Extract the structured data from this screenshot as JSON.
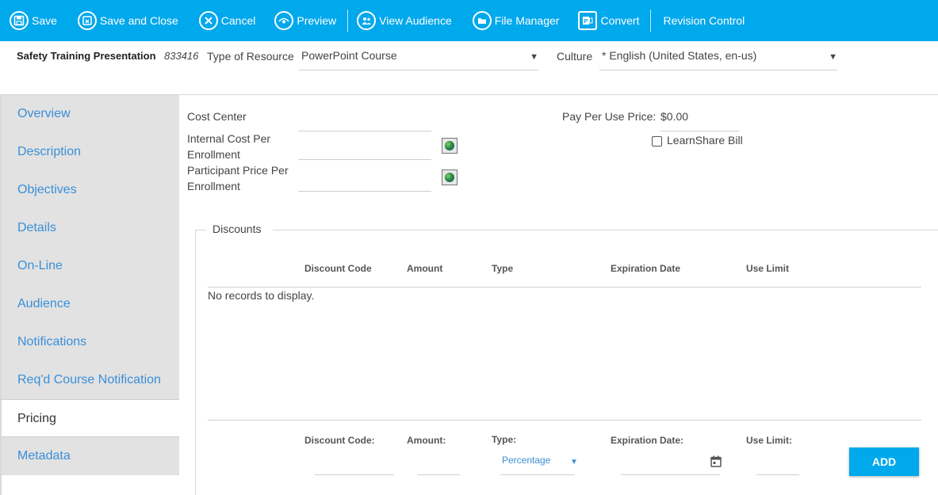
{
  "toolbar": {
    "save": "Save",
    "save_and_close": "Save and Close",
    "cancel": "Cancel",
    "preview": "Preview",
    "view_audience": "View Audience",
    "file_manager": "File Manager",
    "convert": "Convert",
    "revision_control": "Revision Control",
    "background_color": "#00a8ec"
  },
  "header": {
    "course_title": "Safety Training Presentation",
    "course_id": "833416",
    "type_of_resource_label": "Type of Resource",
    "type_of_resource_value": "PowerPoint Course",
    "culture_label": "Culture",
    "culture_value": "* English (United States, en-us)"
  },
  "sidebar": {
    "items": [
      {
        "label": "Overview"
      },
      {
        "label": "Description"
      },
      {
        "label": "Objectives"
      },
      {
        "label": "Details"
      },
      {
        "label": "On-Line"
      },
      {
        "label": "Audience"
      },
      {
        "label": "Notifications"
      },
      {
        "label": "Req'd Course Notification"
      },
      {
        "label": "Pricing"
      },
      {
        "label": "Metadata"
      }
    ],
    "active": "Pricing",
    "link_color": "#3a8fd8"
  },
  "pricing": {
    "cost_center_label": "Cost Center",
    "internal_cost_label_1": "Internal Cost Per",
    "internal_cost_label_2": "Enrollment",
    "participant_price_label_1": "Participant Price Per",
    "participant_price_label_2": "Enrollment",
    "pay_per_use_label": "Pay Per Use Price:",
    "pay_per_use_value": "$0.00",
    "learnshare_bill_label": "LearnShare Bill"
  },
  "discounts": {
    "legend": "Discounts",
    "columns": [
      "Discount Code",
      "Amount",
      "Type",
      "Expiration Date",
      "Use Limit"
    ],
    "empty_message": "No records to display.",
    "form": {
      "discount_code_label": "Discount Code:",
      "amount_label": "Amount:",
      "type_label": "Type:",
      "type_value": "Percentage",
      "expiration_date_label": "Expiration Date:",
      "use_limit_label": "Use Limit:",
      "add_button": "ADD"
    }
  }
}
